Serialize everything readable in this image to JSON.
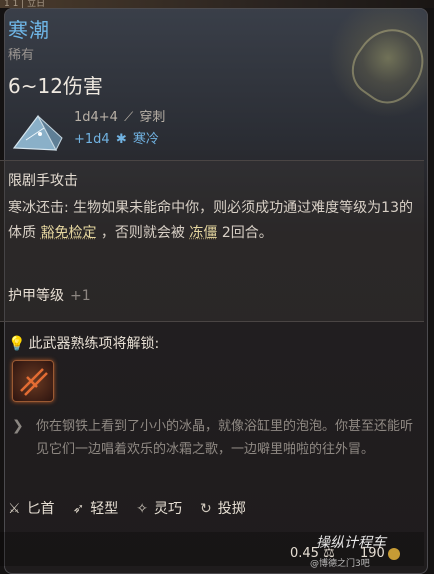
{
  "item": {
    "name": "寒潮",
    "rarity": "稀有",
    "damage": "6~12伤害",
    "dmg_primary": "1d4+4",
    "dmg_primary_type": "穿刺",
    "dmg_bonus": "+1d4",
    "dmg_bonus_type": "寒冷",
    "name_color": "#6fb6e6",
    "cold_color": "#71b3e2"
  },
  "ability": {
    "title": "限剧手攻击",
    "desc_prefix": "寒冰还击: 生物如果未能命中你，则必须成功通过难度等级为13的体质",
    "save": "豁免检定",
    "desc_mid": "，否则就会被",
    "status": "冻僵",
    "desc_suffix": "2回合。"
  },
  "armor": {
    "label": "护甲等级",
    "value": "+1"
  },
  "proficiency": {
    "label": "此武器熟练项将解锁:"
  },
  "flavor": "你在钢铁上看到了小小的冰晶，就像浴缸里的泡泡。你甚至还能听见它们一边唱着欢乐的冰霜之歌，一边噼里啪啦的往外冒。",
  "properties": [
    {
      "icon": "dagger-icon",
      "label": "匕首"
    },
    {
      "icon": "feather-icon",
      "label": "轻型"
    },
    {
      "icon": "finesse-icon",
      "label": "灵巧"
    },
    {
      "icon": "throw-icon",
      "label": "投掷"
    }
  ],
  "footer": {
    "weight": "0.45",
    "price": "190"
  },
  "watermark": {
    "line1": "操纵计程车",
    "line2": "@博德之门3吧"
  },
  "topbar": {
    "text": "1 1 | 立日"
  }
}
